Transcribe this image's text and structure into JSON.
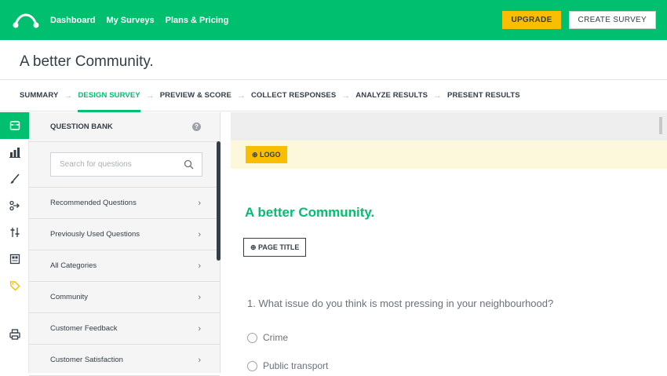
{
  "topbar": {
    "nav": [
      "Dashboard",
      "My Surveys",
      "Plans & Pricing"
    ],
    "upgrade_label": "UPGRADE",
    "create_label": "CREATE SURVEY",
    "brand_color": "#00bf6f"
  },
  "survey": {
    "title": "A better Community."
  },
  "steps": {
    "items": [
      "SUMMARY",
      "DESIGN SURVEY",
      "PREVIEW & SCORE",
      "COLLECT RESPONSES",
      "ANALYZE RESULTS",
      "PRESENT RESULTS"
    ],
    "active": "DESIGN SURVEY"
  },
  "rail": {
    "icons": [
      "question-bank-icon",
      "builder-icon",
      "theme-icon",
      "logic-icon",
      "options-icon",
      "print-icon",
      "tag-icon",
      "printer-icon"
    ]
  },
  "panel": {
    "title": "QUESTION BANK",
    "help": "?",
    "search_placeholder": "Search for questions",
    "items": [
      "Recommended Questions",
      "Previously Used Questions",
      "All Categories",
      "Community",
      "Customer Feedback",
      "Customer Satisfaction"
    ]
  },
  "canvas": {
    "logo_button": "⊕ LOGO",
    "page_title": "A better Community.",
    "page_title_button": "⊕ PAGE TITLE",
    "question": "1. What issue do you think is most pressing in your neighbourhood?",
    "options": [
      "Crime",
      "Public transport"
    ]
  }
}
